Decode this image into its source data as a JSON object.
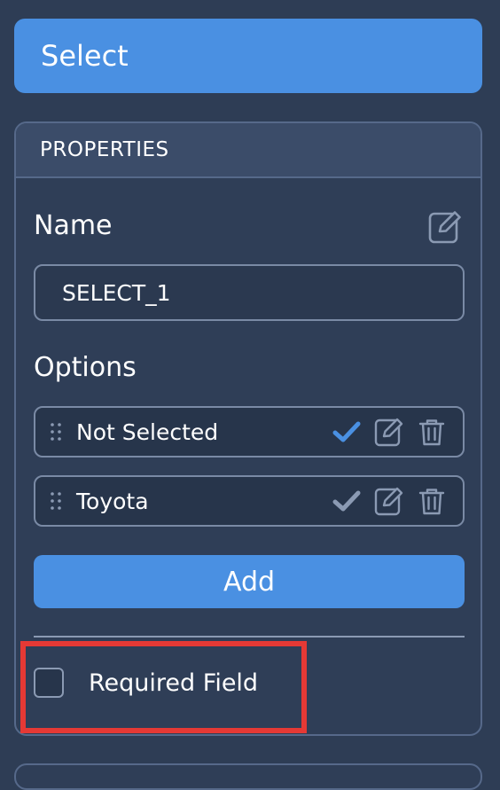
{
  "header": {
    "title": "Select"
  },
  "properties": {
    "heading": "PROPERTIES",
    "name_label": "Name",
    "name_value": "SELECT_1",
    "options_label": "Options",
    "options": [
      {
        "label": "Not Selected",
        "selected": true
      },
      {
        "label": "Toyota",
        "selected": false
      }
    ],
    "add_label": "Add",
    "required_label": "Required Field",
    "required_checked": false
  },
  "colors": {
    "accent": "#4a90e2",
    "background": "#2e3d55",
    "highlight": "#e53935"
  },
  "icons": {
    "name_edit": "edit-icon",
    "drag": "drag-handle-icon",
    "check": "check-icon",
    "edit": "edit-icon",
    "delete": "trash-icon"
  }
}
